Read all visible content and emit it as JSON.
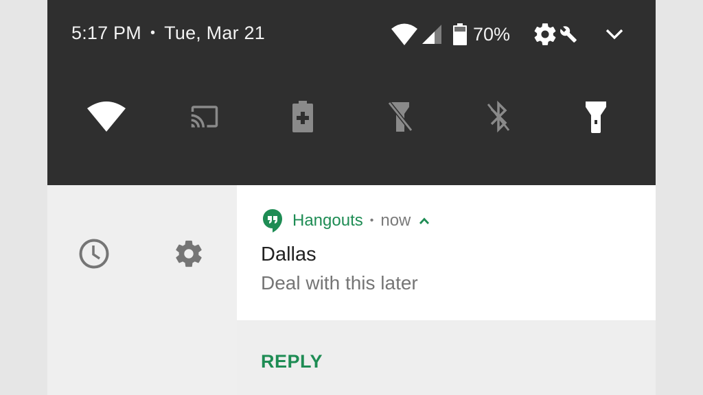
{
  "status_bar": {
    "time": "5:17 PM",
    "separator": "•",
    "date": "Tue, Mar 21",
    "battery_percent": "70%",
    "icons": [
      "wifi-icon",
      "cell-signal-icon",
      "battery-icon",
      "settings-gear-icon",
      "wrench-icon",
      "expand-chevron-icon"
    ]
  },
  "quick_settings": [
    {
      "name": "wifi",
      "icon": "wifi-icon",
      "state": "on"
    },
    {
      "name": "cast",
      "icon": "cast-icon",
      "state": "off"
    },
    {
      "name": "battery-saver",
      "icon": "battery-saver-icon",
      "state": "off"
    },
    {
      "name": "flashlight",
      "icon": "flashlight-off-icon",
      "state": "off"
    },
    {
      "name": "bluetooth",
      "icon": "bluetooth-off-icon",
      "state": "off"
    },
    {
      "name": "flashlight-on",
      "icon": "flashlight-on-icon",
      "state": "on"
    }
  ],
  "notification_actions": {
    "icons": [
      "snooze-clock-icon",
      "notification-settings-icon"
    ]
  },
  "notification": {
    "app_name": "Hangouts",
    "separator": "•",
    "time": "now",
    "title": "Dallas",
    "body": "Deal with this later",
    "action_reply": "REPLY"
  },
  "colors": {
    "shade_bg": "#2f2f2f",
    "accent_green": "#1e8c54",
    "icon_dim": "#8a8a8a",
    "page_bg": "#efefef"
  }
}
